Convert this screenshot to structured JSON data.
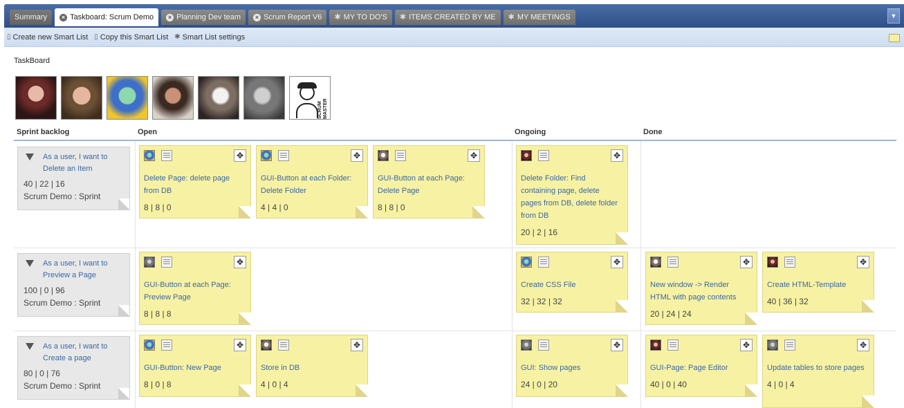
{
  "tabs": [
    {
      "label": "Summary",
      "icon": "none",
      "state": "normal"
    },
    {
      "label": "Taskboard: Scrum Demo",
      "icon": "close-icon",
      "state": "active"
    },
    {
      "label": "Planning Dev team",
      "icon": "close-icon",
      "state": "normal"
    },
    {
      "label": "Scrum Report V6",
      "icon": "close-icon",
      "state": "normal"
    },
    {
      "label": "MY TO DO'S",
      "icon": "gear-icon",
      "state": "normal"
    },
    {
      "label": "ITEMS CREATED BY ME",
      "icon": "gear-icon",
      "state": "normal"
    },
    {
      "label": "MY MEETINGS",
      "icon": "gear-icon",
      "state": "normal"
    }
  ],
  "toolbar": {
    "create": "Create new Smart List",
    "copy": "Copy this Smart List",
    "settings": "Smart List settings"
  },
  "board": {
    "title": "TaskBoard",
    "scrum_master_text": "SCRUM MASTER",
    "columns": [
      "Sprint backlog",
      "Open",
      "Ongoing",
      "Done"
    ]
  },
  "stories": [
    {
      "title": "As a user, I want to Delete an Item",
      "nums": "40 | 22 | 16",
      "sprint": "Scrum Demo : Sprint"
    },
    {
      "title": "As a user, I want to Preview a Page",
      "nums": "100 | 0 | 96",
      "sprint": "Scrum Demo : Sprint"
    },
    {
      "title": "As a user, I want to Create a page",
      "nums": "80 | 0 | 76",
      "sprint": "Scrum Demo : Sprint"
    }
  ],
  "tasks": {
    "r1_open_1": {
      "title": "Delete Page: delete page from DB",
      "nums": "8 | 8 | 0"
    },
    "r1_open_2": {
      "title": "GUI-Button at each Folder: Delete Folder",
      "nums": "4 | 4 | 0"
    },
    "r1_open_3": {
      "title": "GUI-Button at each Page: Delete Page",
      "nums": "8 | 8 | 0"
    },
    "r1_ongoing_1": {
      "title": "Delete Folder: Find containing page, delete pages from DB, delete folder from DB",
      "nums": "20 | 2 | 16"
    },
    "r2_open_1": {
      "title": "GUI-Button at each Page: Preview Page",
      "nums": "8 | 8 | 8"
    },
    "r2_ongoing_1": {
      "title": "Create CSS File",
      "nums": "32 | 32 | 32"
    },
    "r2_done_1": {
      "title": "New window -> Render HTML with page contents",
      "nums": "20 | 24 | 24"
    },
    "r2_done_2": {
      "title": "Create HTML-Template",
      "nums": "40 | 36 | 32"
    },
    "r3_open_1": {
      "title": "GUI-Button: New Page",
      "nums": "8 | 0 | 8"
    },
    "r3_open_2": {
      "title": "Store in DB",
      "nums": "4 | 0 | 4"
    },
    "r3_ongoing_1": {
      "title": "GUI: Show pages",
      "nums": "24 | 0 | 20"
    },
    "r3_done_1": {
      "title": "GUI-Page: Page Editor",
      "nums": "40 | 0 | 40"
    },
    "r3_done_2": {
      "title": "Update tables to store pages",
      "nums": "4 | 0 | 4"
    }
  }
}
